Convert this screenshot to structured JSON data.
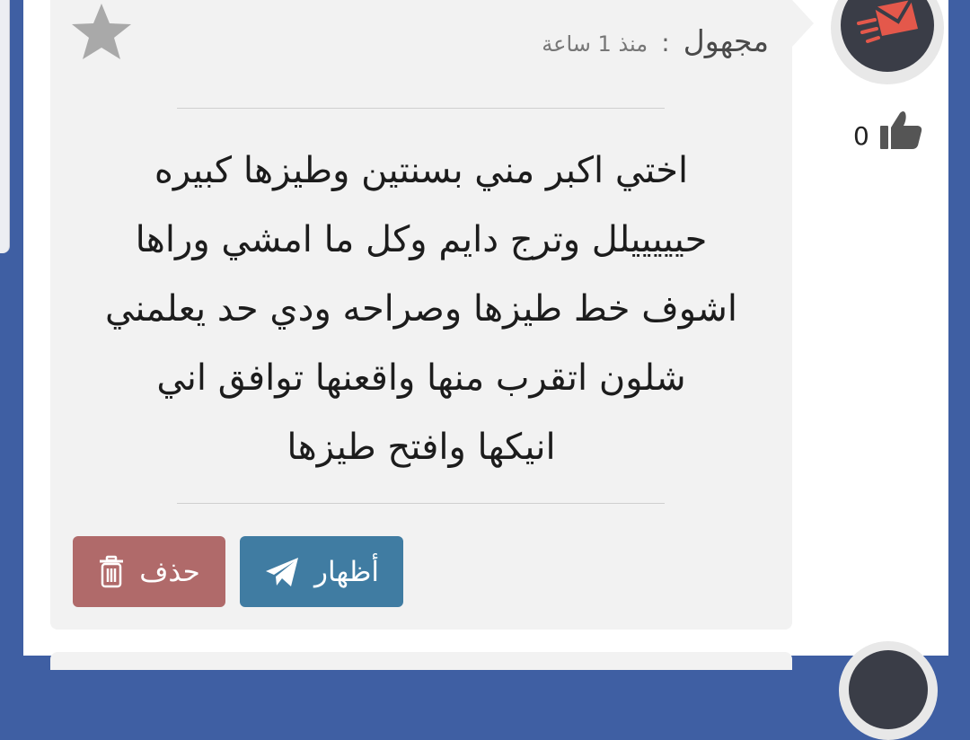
{
  "post": {
    "author": "مجهول",
    "separator": ":",
    "time": "منذ 1 ساعة",
    "message": "اختي اكبر مني بسنتين وطيزها كبيره\nحيييييلل وترج دايم وكل ما امشي وراها\nاشوف خط طيزها وصراحه ودي حد يعلمني\nشلون اتقرب منها واقعنها توافق اني\nانيكها وافتح طيزها",
    "likes": "0"
  },
  "actions": {
    "show_label": "أظهار",
    "delete_label": "حذف"
  },
  "icons": {
    "favorite": "star-icon",
    "show": "send-icon",
    "delete": "trash-icon",
    "like": "thumbs-up-icon",
    "avatar": "envelope-logo-icon"
  },
  "colors": {
    "background": "#3f5fa3",
    "card": "#f2f2f2",
    "show_button": "#407ca2",
    "delete_button": "#b06a6a",
    "avatar": "#3a3d47",
    "avatar_accent": "#e4584b"
  }
}
